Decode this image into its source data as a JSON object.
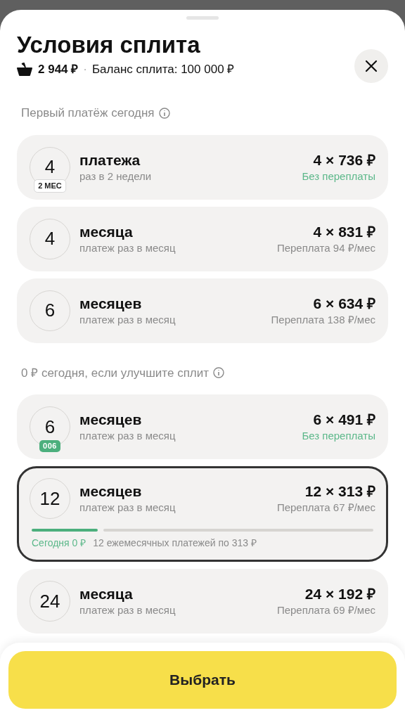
{
  "sheet": {
    "title": "Условия сплита",
    "price": "2 944 ₽",
    "separator": "·",
    "balance": "Баланс сплита: 100 000 ₽"
  },
  "sections": [
    {
      "heading": "Первый платёж сегодня",
      "plans": [
        {
          "count": "4",
          "badge": {
            "kind": "outline",
            "text": "2 МЕС"
          },
          "title": "платежа",
          "subtitle": "раз в 2 недели",
          "amount": "4 × 736 ₽",
          "note": "Без переплаты",
          "positive": true,
          "selected": false
        },
        {
          "count": "4",
          "title": "месяца",
          "subtitle": "платеж раз в месяц",
          "amount": "4 × 831 ₽",
          "note": "Переплата 94 ₽/мес",
          "positive": false,
          "selected": false
        },
        {
          "count": "6",
          "title": "месяцев",
          "subtitle": "платеж раз в месяц",
          "amount": "6 × 634 ₽",
          "note": "Переплата 138 ₽/мес",
          "positive": false,
          "selected": false
        }
      ]
    },
    {
      "heading": "0 ₽ сегодня, если улучшите сплит",
      "plans": [
        {
          "count": "6",
          "badge": {
            "kind": "green",
            "text": "006"
          },
          "title": "месяцев",
          "subtitle": "платеж раз в месяц",
          "amount": "6 × 491 ₽",
          "note": "Без переплаты",
          "positive": true,
          "selected": false
        },
        {
          "count": "12",
          "title": "месяцев",
          "subtitle": "платеж раз в месяц",
          "amount": "12 × 313 ₽",
          "note": "Переплата 67 ₽/мес",
          "positive": false,
          "selected": true,
          "timeline": {
            "today": "Сегодня 0 ₽",
            "rest": "12 ежемесячных платежей по 313 ₽"
          }
        },
        {
          "count": "24",
          "title": "месяца",
          "subtitle": "платеж раз в месяц",
          "amount": "24 × 192 ₽",
          "note": "Переплата 69 ₽/мес",
          "positive": false,
          "selected": false
        }
      ]
    }
  ],
  "button": "Выбрать"
}
